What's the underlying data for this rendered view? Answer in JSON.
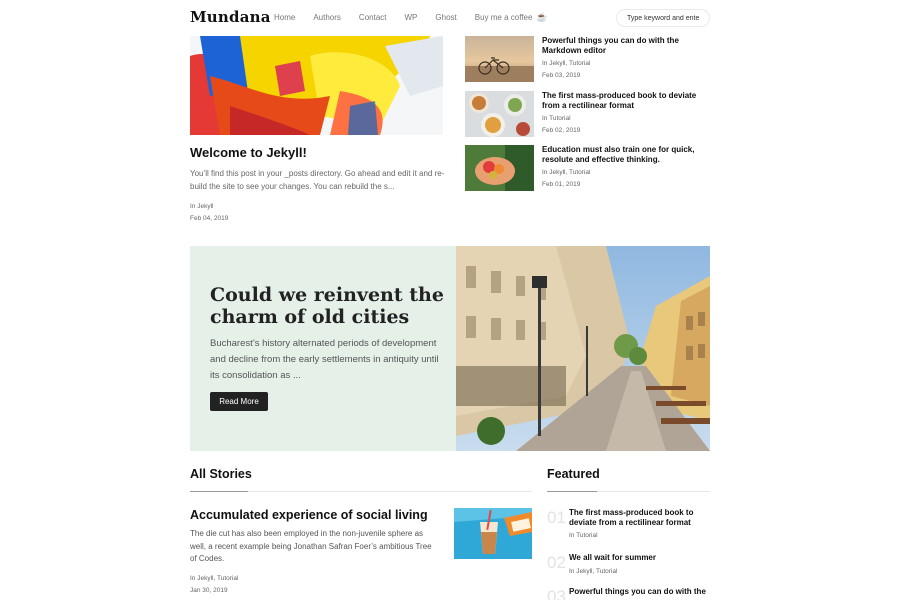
{
  "brand": "Mundana",
  "nav": {
    "links": [
      "Home",
      "Authors",
      "Contact",
      "WP",
      "Ghost"
    ],
    "coffee_label": "Buy me a coffee",
    "search_placeholder": "Type keyword and enter."
  },
  "hero": {
    "title": "Welcome to Jekyll!",
    "excerpt": "You’ll find this post in your _posts directory. Go ahead and edit it and re-build the site to see your changes. You can rebuild the s...",
    "category": "In Jekyll",
    "date": "Feb 04, 2019"
  },
  "side_posts": [
    {
      "title": "Powerful things you can do with the Markdown editor",
      "category": "In Jekyll, Tutorial",
      "date": "Feb 03, 2019",
      "image": "bicycle-sunset-thumbnail"
    },
    {
      "title": "The first mass-produced book to deviate from a rectilinear format",
      "category": "In Tutorial",
      "date": "Feb 02, 2019",
      "image": "food-bowls-thumbnail"
    },
    {
      "title": "Education must also train one for quick, resolute and effective thinking.",
      "category": "In Jekyll, Tutorial",
      "date": "Feb 01, 2019",
      "image": "hands-holding-fruit-thumbnail"
    }
  ],
  "jumbotron": {
    "title": "Could we reinvent the charm of old cities",
    "text": "Bucharest’s history alternated periods of development and decline from the early settlements in antiquity until its consolidation as ...",
    "button": "Read More",
    "image": "old-city-street-photo"
  },
  "all_stories": {
    "heading": "All Stories",
    "post": {
      "title": "Accumulated experience of social living",
      "excerpt": "The die cut has also been employed in the non-juvenile sphere as well, a recent example being Jonathan Safran Foer’s ambitious Tree of Codes.",
      "category": "In Jekyll, Tutorial",
      "date": "Jan 30, 2019",
      "image": "iced-coffee-drink-thumbnail"
    }
  },
  "featured": {
    "heading": "Featured",
    "items": [
      {
        "num": "01",
        "title": "The first mass-produced book to deviate from a rectilinear format",
        "category": "In Tutorial"
      },
      {
        "num": "02",
        "title": "We all wait for summer",
        "category": "In Jekyll, Tutorial"
      },
      {
        "num": "03",
        "title": "Powerful things you can do with the",
        "category": ""
      }
    ]
  },
  "colors": {
    "jumbotron_bg": "#e5f0e8",
    "button_bg": "#222222",
    "coffee_icon": "#d6336c"
  }
}
